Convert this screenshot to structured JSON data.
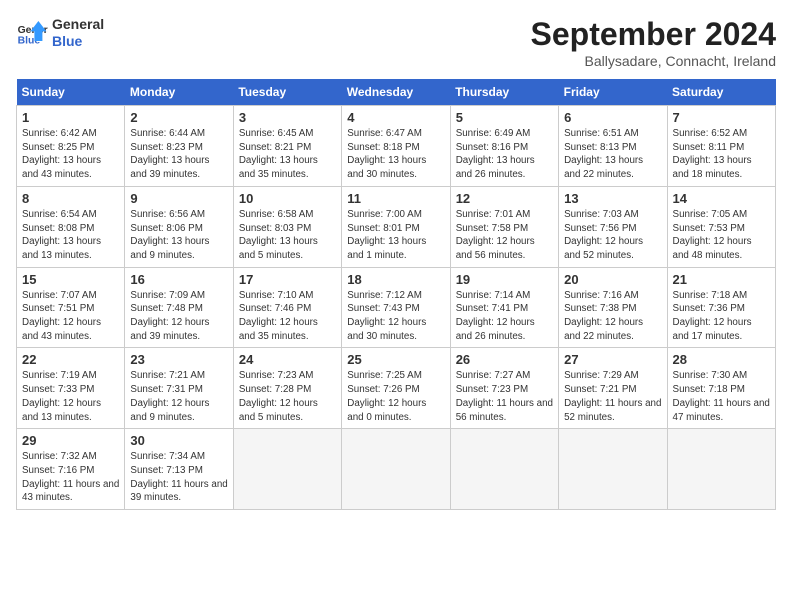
{
  "header": {
    "logo_line1": "General",
    "logo_line2": "Blue",
    "month": "September 2024",
    "location": "Ballysadare, Connacht, Ireland"
  },
  "weekdays": [
    "Sunday",
    "Monday",
    "Tuesday",
    "Wednesday",
    "Thursday",
    "Friday",
    "Saturday"
  ],
  "weeks": [
    [
      {
        "day": "1",
        "info": "Sunrise: 6:42 AM\nSunset: 8:25 PM\nDaylight: 13 hours and 43 minutes."
      },
      {
        "day": "2",
        "info": "Sunrise: 6:44 AM\nSunset: 8:23 PM\nDaylight: 13 hours and 39 minutes."
      },
      {
        "day": "3",
        "info": "Sunrise: 6:45 AM\nSunset: 8:21 PM\nDaylight: 13 hours and 35 minutes."
      },
      {
        "day": "4",
        "info": "Sunrise: 6:47 AM\nSunset: 8:18 PM\nDaylight: 13 hours and 30 minutes."
      },
      {
        "day": "5",
        "info": "Sunrise: 6:49 AM\nSunset: 8:16 PM\nDaylight: 13 hours and 26 minutes."
      },
      {
        "day": "6",
        "info": "Sunrise: 6:51 AM\nSunset: 8:13 PM\nDaylight: 13 hours and 22 minutes."
      },
      {
        "day": "7",
        "info": "Sunrise: 6:52 AM\nSunset: 8:11 PM\nDaylight: 13 hours and 18 minutes."
      }
    ],
    [
      {
        "day": "8",
        "info": "Sunrise: 6:54 AM\nSunset: 8:08 PM\nDaylight: 13 hours and 13 minutes."
      },
      {
        "day": "9",
        "info": "Sunrise: 6:56 AM\nSunset: 8:06 PM\nDaylight: 13 hours and 9 minutes."
      },
      {
        "day": "10",
        "info": "Sunrise: 6:58 AM\nSunset: 8:03 PM\nDaylight: 13 hours and 5 minutes."
      },
      {
        "day": "11",
        "info": "Sunrise: 7:00 AM\nSunset: 8:01 PM\nDaylight: 13 hours and 1 minute."
      },
      {
        "day": "12",
        "info": "Sunrise: 7:01 AM\nSunset: 7:58 PM\nDaylight: 12 hours and 56 minutes."
      },
      {
        "day": "13",
        "info": "Sunrise: 7:03 AM\nSunset: 7:56 PM\nDaylight: 12 hours and 52 minutes."
      },
      {
        "day": "14",
        "info": "Sunrise: 7:05 AM\nSunset: 7:53 PM\nDaylight: 12 hours and 48 minutes."
      }
    ],
    [
      {
        "day": "15",
        "info": "Sunrise: 7:07 AM\nSunset: 7:51 PM\nDaylight: 12 hours and 43 minutes."
      },
      {
        "day": "16",
        "info": "Sunrise: 7:09 AM\nSunset: 7:48 PM\nDaylight: 12 hours and 39 minutes."
      },
      {
        "day": "17",
        "info": "Sunrise: 7:10 AM\nSunset: 7:46 PM\nDaylight: 12 hours and 35 minutes."
      },
      {
        "day": "18",
        "info": "Sunrise: 7:12 AM\nSunset: 7:43 PM\nDaylight: 12 hours and 30 minutes."
      },
      {
        "day": "19",
        "info": "Sunrise: 7:14 AM\nSunset: 7:41 PM\nDaylight: 12 hours and 26 minutes."
      },
      {
        "day": "20",
        "info": "Sunrise: 7:16 AM\nSunset: 7:38 PM\nDaylight: 12 hours and 22 minutes."
      },
      {
        "day": "21",
        "info": "Sunrise: 7:18 AM\nSunset: 7:36 PM\nDaylight: 12 hours and 17 minutes."
      }
    ],
    [
      {
        "day": "22",
        "info": "Sunrise: 7:19 AM\nSunset: 7:33 PM\nDaylight: 12 hours and 13 minutes."
      },
      {
        "day": "23",
        "info": "Sunrise: 7:21 AM\nSunset: 7:31 PM\nDaylight: 12 hours and 9 minutes."
      },
      {
        "day": "24",
        "info": "Sunrise: 7:23 AM\nSunset: 7:28 PM\nDaylight: 12 hours and 5 minutes."
      },
      {
        "day": "25",
        "info": "Sunrise: 7:25 AM\nSunset: 7:26 PM\nDaylight: 12 hours and 0 minutes."
      },
      {
        "day": "26",
        "info": "Sunrise: 7:27 AM\nSunset: 7:23 PM\nDaylight: 11 hours and 56 minutes."
      },
      {
        "day": "27",
        "info": "Sunrise: 7:29 AM\nSunset: 7:21 PM\nDaylight: 11 hours and 52 minutes."
      },
      {
        "day": "28",
        "info": "Sunrise: 7:30 AM\nSunset: 7:18 PM\nDaylight: 11 hours and 47 minutes."
      }
    ],
    [
      {
        "day": "29",
        "info": "Sunrise: 7:32 AM\nSunset: 7:16 PM\nDaylight: 11 hours and 43 minutes."
      },
      {
        "day": "30",
        "info": "Sunrise: 7:34 AM\nSunset: 7:13 PM\nDaylight: 11 hours and 39 minutes."
      },
      {
        "day": "",
        "info": ""
      },
      {
        "day": "",
        "info": ""
      },
      {
        "day": "",
        "info": ""
      },
      {
        "day": "",
        "info": ""
      },
      {
        "day": "",
        "info": ""
      }
    ]
  ]
}
